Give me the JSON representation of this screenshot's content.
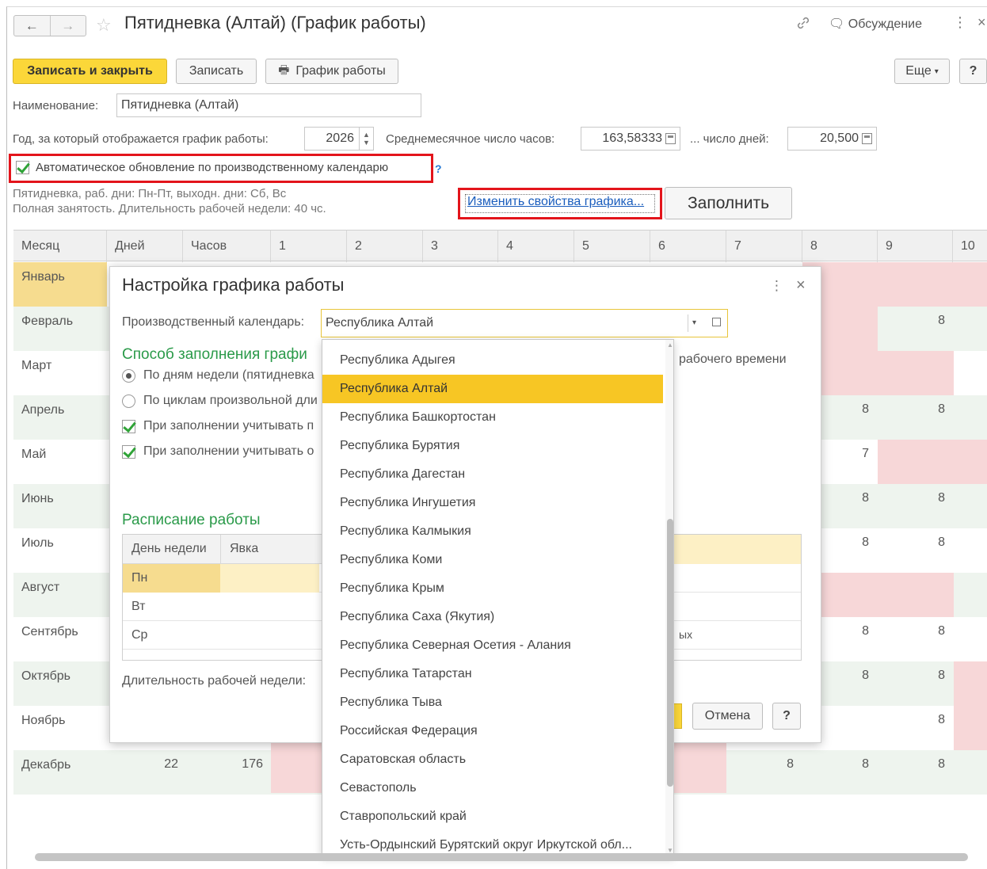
{
  "window": {
    "title": "Пятидневка (Алтай) (График работы)",
    "discussion_label": "Обсуждение",
    "nav_back": "←",
    "nav_forward": "→",
    "star_icon": "☆",
    "kebab": "⋮",
    "close": "×"
  },
  "toolbar": {
    "save_close": "Записать и закрыть",
    "save": "Записать",
    "schedule": "График работы",
    "more": "Еще",
    "more_arrow": "▾",
    "help": "?"
  },
  "form": {
    "name_label": "Наименование:",
    "name_value": "Пятидневка (Алтай)",
    "year_label": "Год, за который отображается график работы:",
    "year_value": "2026",
    "avg_hours_label": "Среднемесячное число часов:",
    "avg_hours_value": "163,58333",
    "days_label": "... число дней:",
    "days_value": "20,500",
    "auto_update_label": "Автоматическое обновление по производственному календарю",
    "auto_update_checked": true,
    "question": "?",
    "info_line1": "Пятидневка, раб. дни: Пн-Пт, выходн. дни: Сб, Вс",
    "info_line2": "Полная занятость. Длительность рабочей недели: 40 чс.",
    "change_link": "Изменить свойства графика...",
    "fill_button": "Заполнить"
  },
  "grid": {
    "headers": [
      "Месяц",
      "Дней",
      "Часов",
      "1",
      "2",
      "3",
      "4",
      "5",
      "6",
      "7",
      "8",
      "9",
      "10"
    ],
    "months": [
      "Январь",
      "Февраль",
      "Март",
      "Апрель",
      "Май",
      "Июнь",
      "Июль",
      "Август",
      "Сентябрь",
      "Октябрь",
      "Ноябрь",
      "Декабрь"
    ],
    "visible_values": {
      "feb_9": "8",
      "apr_8": "8",
      "apr_9": "8",
      "may_8": "7",
      "jun_8": "8",
      "jun_9": "8",
      "jul_8": "8",
      "jul_9": "8",
      "sep_8": "8",
      "sep_9": "8",
      "oct_8": "8",
      "oct_9": "8",
      "nov_9": "8",
      "dec_days": "22",
      "dec_hours": "176",
      "dec_7": "8",
      "dec_8": "8",
      "dec_9": "8"
    }
  },
  "modal": {
    "title": "Настройка графика работы",
    "calendar_label": "Производственный календарь:",
    "calendar_value": "Республика Алтай",
    "fill_method_title": "Способ заполнения графи",
    "opt_weekdays": "По дням недели (пятидневка",
    "opt_cycles": "По циклам произвольной дли",
    "cb_consider1": "При заполнении учитывать п",
    "cb_consider2": "При заполнении учитывать о",
    "right_fragment": "рабочего времени",
    "schedule_title": "Расписание работы",
    "sched_col_day": "День недели",
    "sched_col_presence": "Явка",
    "sched_days": [
      "Пн",
      "Вт",
      "Ср"
    ],
    "sched_right_fragment": "ых",
    "week_length_label": "Длительность рабочей недели:",
    "cancel": "Отмена",
    "help": "?"
  },
  "dropdown": {
    "items": [
      "Республика Адыгея",
      "Республика Алтай",
      "Республика Башкортостан",
      "Республика Бурятия",
      "Республика Дагестан",
      "Республика Ингушетия",
      "Республика Калмыкия",
      "Республика Коми",
      "Республика Крым",
      "Республика Саха (Якутия)",
      "Республика Северная Осетия - Алания",
      "Республика Татарстан",
      "Республика Тыва",
      "Российская Федерация",
      "Саратовская область",
      "Севастополь",
      "Ставропольский край",
      "Усть-Ордынский Бурятский округ Иркутской обл..."
    ],
    "selected_index": 1
  },
  "colors": {
    "primary_button": "#fbd739",
    "selection": "#f7c624",
    "highlight_red": "#e3141b",
    "section_green": "#2a9a49",
    "weekend_pink": "#f7d7d8",
    "link_blue": "#1a5dbd"
  }
}
